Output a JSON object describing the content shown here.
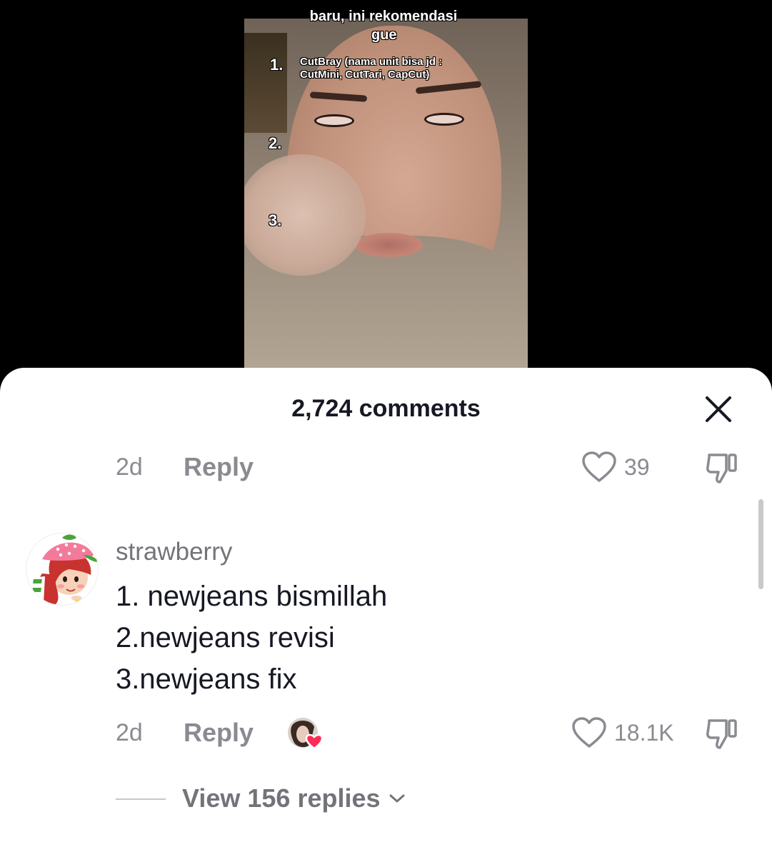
{
  "video": {
    "overlay": {
      "top_line": "baru, ini rekomendasi",
      "top_line_2": "gue",
      "item1_number": "1.",
      "item1_text": "CutBray (nama unit bisa jd : CutMini, CutTari, CapCut)",
      "item2_number": "2.",
      "item3_number": "3."
    }
  },
  "sheet": {
    "title": "2,724 comments"
  },
  "previous_comment": {
    "age": "2d",
    "reply_label": "Reply",
    "like_count": "39"
  },
  "comment": {
    "username": "strawberry",
    "lines": [
      "1. newjeans bismillah",
      "2.newjeans revisi",
      "3.newjeans fix"
    ],
    "age": "2d",
    "reply_label": "Reply",
    "like_count": "18.1K",
    "view_replies": "View 156 replies"
  },
  "colors": {
    "like_heart_accent": "#fe2c55",
    "text_primary": "#161823",
    "text_secondary": "#8a8b91"
  }
}
